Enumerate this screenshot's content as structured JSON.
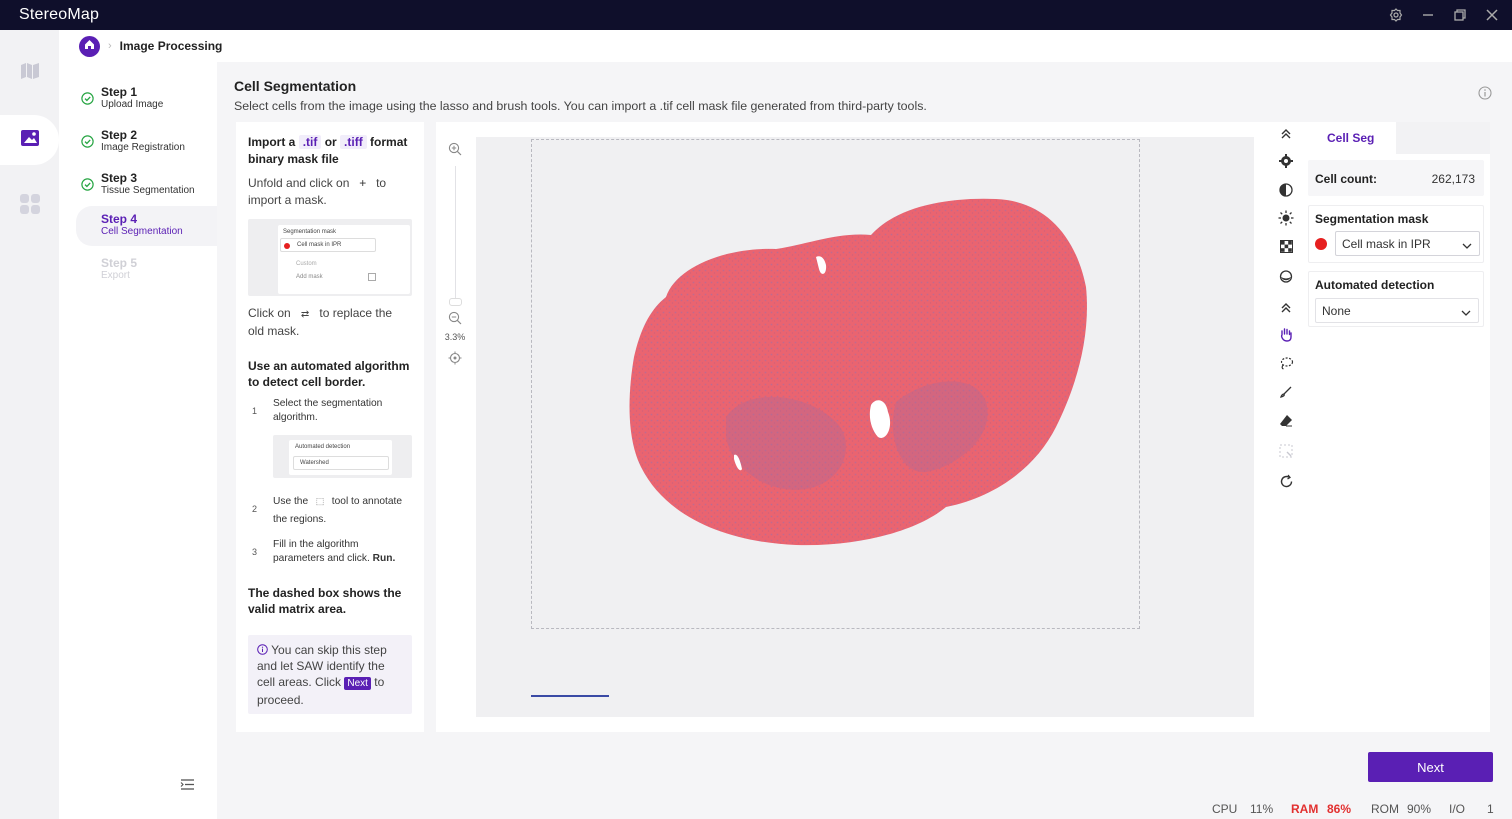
{
  "app": {
    "title": "StereoMap"
  },
  "window_controls": {
    "settings_icon": "gear-icon",
    "minimize_icon": "minimize-icon",
    "restore_icon": "restore-icon",
    "close_icon": "close-icon"
  },
  "nav_rail": {
    "items": [
      {
        "icon": "map-icon"
      },
      {
        "icon": "image-icon",
        "active": true
      },
      {
        "icon": "apps-icon"
      }
    ]
  },
  "breadcrumb": {
    "home_icon": "home-icon",
    "current": "Image Processing"
  },
  "steps": [
    {
      "label": "Step 1",
      "name": "Upload Image",
      "state": "done"
    },
    {
      "label": "Step 2",
      "name": "Image Registration",
      "state": "done"
    },
    {
      "label": "Step 3",
      "name": "Tissue Segmentation",
      "state": "done"
    },
    {
      "label": "Step 4",
      "name": "Cell Segmentation",
      "state": "active"
    },
    {
      "label": "Step 5",
      "name": "Export",
      "state": "disabled"
    }
  ],
  "main": {
    "title": "Cell Segmentation",
    "description": "Select cells from the image using the lasso and brush tools. You can import a .tif cell mask file generated from third-party tools."
  },
  "guide": {
    "import_pre": "Import a",
    "tif": ".tif",
    "or": "or",
    "tiff": ".tiff",
    "format": "format",
    "binary_line": "binary mask file",
    "unfold_line1a": "Unfold and click on",
    "plus": "+",
    "unfold_line1b": "to",
    "unfold_line2": "import a mask.",
    "shot1": {
      "title": "Segmentation mask",
      "value": "Cell mask in IPR",
      "custom": "Custom",
      "add": "Add mask"
    },
    "replace_a": "Click on",
    "replace_icon": "swap-icon",
    "replace_b": "to replace the",
    "replace_c": "old mask.",
    "auto_title1": "Use an automated algorithm",
    "auto_title2": "to detect cell border.",
    "s1_num": "1",
    "s1_text1": "Select the segmentation",
    "s1_text2": "algorithm.",
    "shot2": {
      "title": "Automated detection",
      "value": "Watershed"
    },
    "s2_num": "2",
    "s2_text1a": "Use the",
    "s2_text1b": "tool to annotate",
    "s2_text2": "the regions.",
    "s3_num": "3",
    "s3_text1": "Fill in the algorithm",
    "s3_text2": "parameters and click.",
    "s3_run": "Run.",
    "dashed1": "The dashed box shows the",
    "dashed2": "valid matrix area.",
    "tip": {
      "l1": "You can skip this step",
      "l2": "and let SAW identify the",
      "l3a": "cell areas. Click",
      "next": "Next",
      "l3b": "to",
      "l4": "proceed."
    }
  },
  "zoom": {
    "level": "3.3%",
    "in_icon": "zoom-in-icon",
    "out_icon": "zoom-out-icon",
    "fit_icon": "locate-icon"
  },
  "tools": [
    {
      "icon": "collapse-up-icon"
    },
    {
      "icon": "settings-icon"
    },
    {
      "icon": "contrast-icon"
    },
    {
      "icon": "brightness-icon"
    },
    {
      "icon": "checker-icon"
    },
    {
      "icon": "drop-icon"
    },
    {
      "icon": "collapse-up-icon"
    },
    {
      "icon": "hand-icon",
      "active": true
    },
    {
      "icon": "lasso-icon"
    },
    {
      "icon": "brush-icon"
    },
    {
      "icon": "eraser-icon"
    },
    {
      "icon": "select-region-icon",
      "disabled": true
    },
    {
      "icon": "rotate-icon"
    }
  ],
  "panel": {
    "tab": "Cell Seg",
    "cell_count_label": "Cell count:",
    "cell_count": "262,173",
    "seg_mask_title": "Segmentation mask",
    "seg_mask_value": "Cell mask in IPR",
    "seg_mask_color": "#e62020",
    "auto_title": "Automated detection",
    "auto_value": "None"
  },
  "next_button": "Next",
  "status": {
    "cpu_label": "CPU",
    "cpu": "11%",
    "ram_label": "RAM",
    "ram": "86%",
    "rom_label": "ROM",
    "rom": "90%",
    "io_label": "I/O",
    "io": "1"
  },
  "colors": {
    "accent": "#5a1fb4",
    "titlebar": "#0f0f2b",
    "tissue": "#ea6470",
    "ram_alert": "#e23030"
  }
}
